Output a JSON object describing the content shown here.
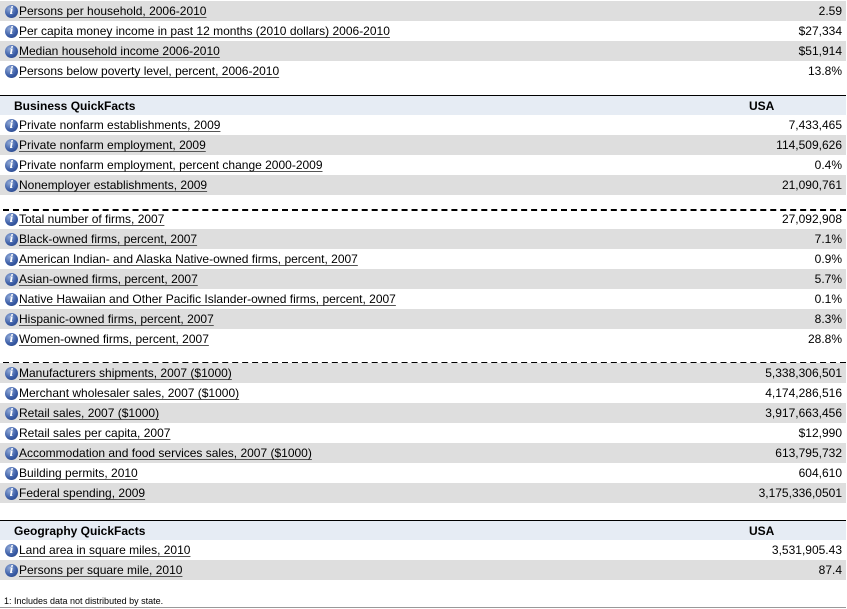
{
  "people_tail": [
    {
      "label": "Persons per household, 2006-2010",
      "value": "2.59"
    },
    {
      "label": "Per capita money income in past 12 months (2010 dollars) 2006-2010",
      "value": "$27,334"
    },
    {
      "label": "Median household income 2006-2010",
      "value": "$51,914"
    },
    {
      "label": "Persons below poverty level, percent, 2006-2010",
      "value": "13.8%"
    }
  ],
  "business": {
    "title": "Business QuickFacts",
    "column": "USA",
    "group1": [
      {
        "label": "Private nonfarm establishments, 2009",
        "value": "7,433,465"
      },
      {
        "label": "Private nonfarm employment, 2009",
        "value": "114,509,626"
      },
      {
        "label": "Private nonfarm employment, percent change 2000-2009",
        "value": "0.4%"
      },
      {
        "label": "Nonemployer establishments, 2009",
        "value": "21,090,761"
      }
    ],
    "group2": [
      {
        "label": "Total number of firms, 2007",
        "value": "27,092,908"
      },
      {
        "label": "Black-owned firms, percent, 2007",
        "value": "7.1%"
      },
      {
        "label": "American Indian- and Alaska Native-owned firms, percent, 2007",
        "value": "0.9%"
      },
      {
        "label": "Asian-owned firms, percent, 2007",
        "value": "5.7%"
      },
      {
        "label": "Native Hawaiian and Other Pacific Islander-owned firms, percent, 2007",
        "value": "0.1%"
      },
      {
        "label": "Hispanic-owned firms, percent, 2007",
        "value": "8.3%"
      },
      {
        "label": "Women-owned firms, percent, 2007",
        "value": "28.8%"
      }
    ],
    "group3": [
      {
        "label": "Manufacturers shipments, 2007 ($1000)",
        "value": "5,338,306,501"
      },
      {
        "label": "Merchant wholesaler sales, 2007 ($1000)",
        "value": "4,174,286,516"
      },
      {
        "label": "Retail sales, 2007 ($1000)",
        "value": "3,917,663,456"
      },
      {
        "label": "Retail sales per capita, 2007",
        "value": "$12,990"
      },
      {
        "label": "Accommodation and food services sales, 2007 ($1000)",
        "value": "613,795,732"
      },
      {
        "label": "Building permits, 2010",
        "value": "604,610"
      },
      {
        "label": "Federal spending, 2009",
        "value": "3,175,336,0501"
      }
    ]
  },
  "geography": {
    "title": "Geography QuickFacts",
    "column": "USA",
    "rows": [
      {
        "label": "Land area in square miles, 2010",
        "value": "3,531,905.43"
      },
      {
        "label": "Persons per square mile, 2010",
        "value": "87.4"
      }
    ]
  },
  "info_icon_glyph": "i",
  "footnote": "1: Includes data not distributed by state."
}
